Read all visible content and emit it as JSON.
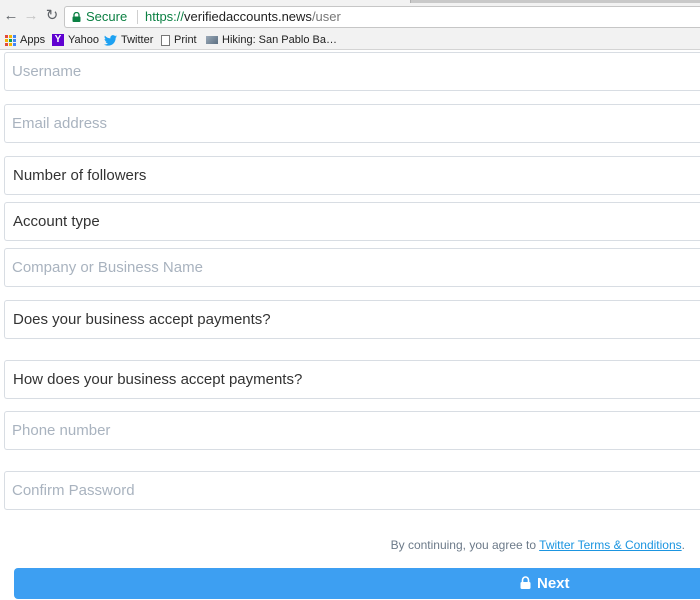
{
  "browser": {
    "secure_label": "Secure",
    "url": {
      "scheme": "https://",
      "host": "verifiedaccounts.news",
      "path": "/user"
    },
    "bookmarks": [
      {
        "label": "Apps",
        "icon": "apps-grid-icon"
      },
      {
        "label": "Yahoo",
        "icon": "yahoo-icon",
        "glyph": "Y"
      },
      {
        "label": "Twitter",
        "icon": "twitter-bird-icon"
      },
      {
        "label": "Print",
        "icon": "page-icon"
      },
      {
        "label": "Hiking: San Pablo Ba…",
        "icon": "hiking-favicon"
      }
    ]
  },
  "form": {
    "username_placeholder": "Username",
    "email_placeholder": "Email address",
    "followers_label": "Number of followers",
    "account_type_label": "Account type",
    "company_placeholder": "Company or Business Name",
    "accept_payments_label": "Does your business accept payments?",
    "payment_method_label": "How does your business accept payments?",
    "phone_placeholder": "Phone number",
    "confirm_password_placeholder": "Confirm Password",
    "terms_prefix": "By continuing, you agree to ",
    "terms_link": "Twitter Terms & Conditions",
    "terms_suffix": ".",
    "next_label": "Next"
  },
  "colors": {
    "accent": "#3d9ff2",
    "link": "#1b95e0",
    "secure_green": "#0b8043",
    "placeholder": "#a9b3bf"
  }
}
